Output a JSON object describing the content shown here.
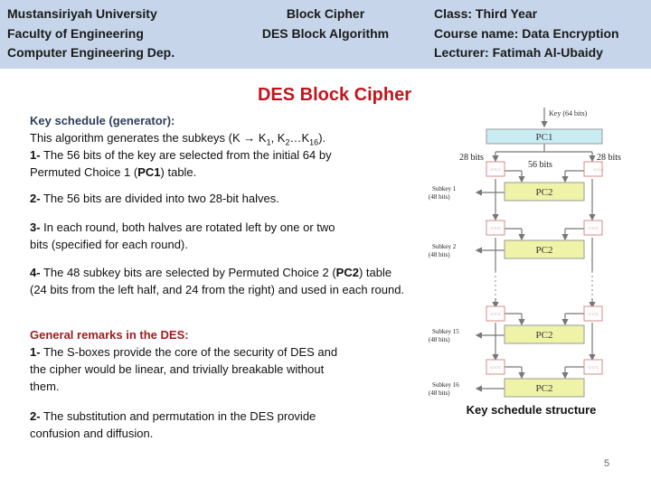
{
  "header": {
    "left": [
      "Mustansiriyah University",
      "Faculty of Engineering",
      "Computer Engineering Dep."
    ],
    "middle": [
      "Block Cipher",
      "DES Block Algorithm"
    ],
    "right": [
      "Class: Third Year",
      "Course name: Data Encryption",
      "Lecturer: Fatimah Al-Ubaidy"
    ]
  },
  "slide_title": "DES Block Cipher",
  "key_schedule": {
    "heading": "Key schedule (generator):",
    "intro_prefix": "This algorithm generates the subkeys (K → K",
    "intro_sub1": "1",
    "intro_mid1": ", K",
    "intro_sub2": "2",
    "intro_mid2": "…K",
    "intro_sub3": "16",
    "intro_suffix": ").",
    "step1_num": "1-",
    "step1_text_a": " The 56 bits of the key are selected from the initial 64 by Permuted Choice 1 (",
    "step1_bold": "PC1",
    "step1_text_b": ") table.",
    "step2_num": "2-",
    "step2_text": " The 56 bits are divided into two 28-bit halves.",
    "step3_num": "3-",
    "step3_text": " In each round, both halves are rotated left by one or two bits (specified for each round).",
    "step4_num": "4-",
    "step4_text_a": " The 48 subkey bits are selected by Permuted Choice 2 (",
    "step4_bold": "PC2",
    "step4_text_b": ") table (24 bits from the left half, and 24 from the right) and used in each round."
  },
  "remarks": {
    "heading": "General remarks in the DES:",
    "r1_num": "1-",
    "r1_text": " The S-boxes provide the core of the security of DES and the cipher would be linear, and trivially breakable without them.",
    "r2_num": "2-",
    "r2_text": " The substitution and permutation in the DES provide confusion and diffusion."
  },
  "diagram": {
    "key_label": "Key (64 bits)",
    "pc1_label": "PC1",
    "left_bits": "28 bits",
    "right_bits": "28 bits",
    "middle_bits": "56 bits",
    "rotate_label": "<<<",
    "pc2_label": "PC2",
    "subkeys": [
      {
        "name": "Subkey 1",
        "size": "(48 bits)"
      },
      {
        "name": "Subkey 2",
        "size": "(48 bits)"
      },
      {
        "name": "Subkey 15",
        "size": "(48 bits)"
      },
      {
        "name": "Subkey 16",
        "size": "(48 bits)"
      }
    ],
    "caption": "Key schedule structure",
    "colors": {
      "pc1_fill": "#c9ecf3",
      "pc2_fill": "#eef3a8",
      "rotate_stroke": "#d98a8a",
      "line": "#777777"
    }
  },
  "page_number": "5"
}
